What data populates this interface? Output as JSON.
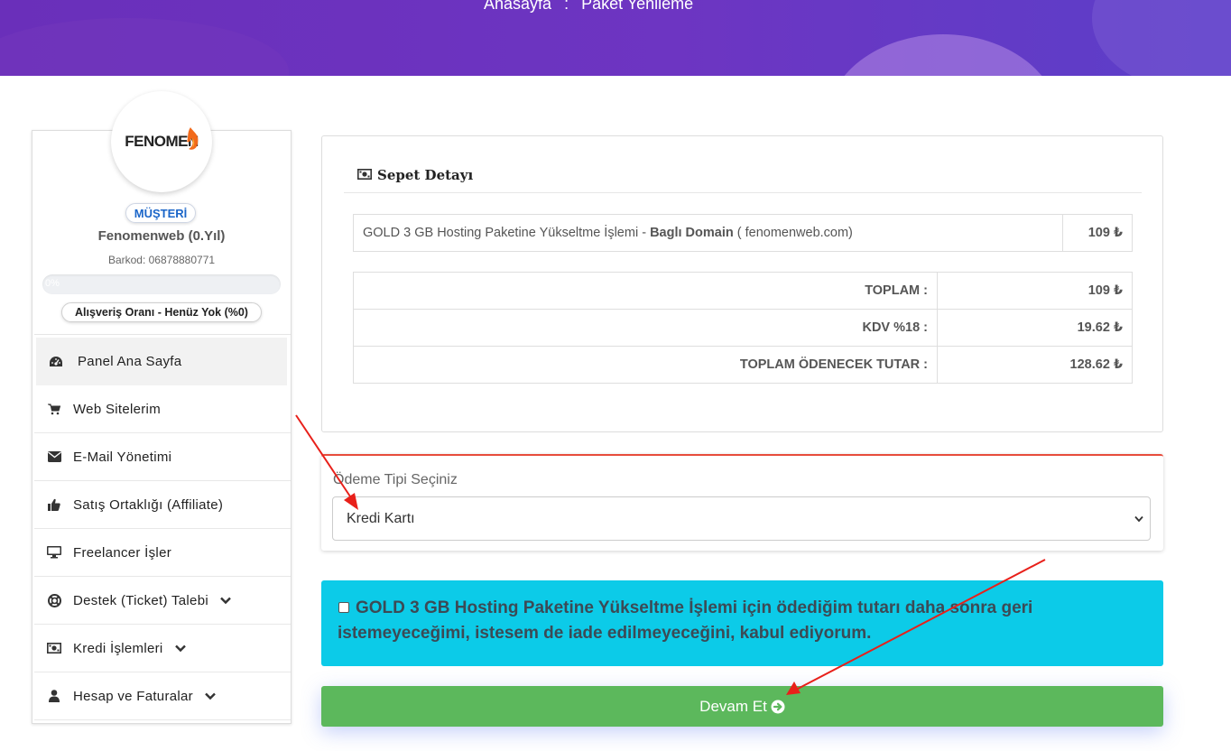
{
  "breadcrumb": {
    "home": "Anasayfa",
    "separator": ":",
    "current": "Paket Yenileme"
  },
  "profile": {
    "logo_text": "FENOMEN",
    "role_badge": "MÜŞTERİ",
    "name": "Fenomenweb (0.Yıl)",
    "barcode": "Barkod: 06878880771",
    "progress_label": "0%",
    "progress_value": 0,
    "shopping_rate": "Alışveriş Oranı - Henüz Yok (%0)"
  },
  "menu": {
    "items": [
      {
        "label": "Panel Ana Sayfa",
        "icon": "dashboard-icon",
        "expandable": false
      },
      {
        "label": "Web Sitelerim",
        "icon": "cart-icon",
        "expandable": false
      },
      {
        "label": "E-Mail Yönetimi",
        "icon": "envelope-icon",
        "expandable": false
      },
      {
        "label": "Satış Ortaklığı (Affiliate)",
        "icon": "thumbs-up-icon",
        "expandable": false
      },
      {
        "label": "Freelancer İşler",
        "icon": "desktop-icon",
        "expandable": false
      },
      {
        "label": "Destek (Ticket) Talebi",
        "icon": "life-ring-icon",
        "expandable": true
      },
      {
        "label": "Kredi İşlemleri",
        "icon": "money-icon",
        "expandable": true
      },
      {
        "label": "Hesap ve Faturalar",
        "icon": "user-icon",
        "expandable": true
      }
    ]
  },
  "cart": {
    "title": "Sepet Detayı",
    "item": {
      "description": "GOLD 3 GB Hosting Paketine Yükseltme İşlemi - ",
      "domain_label": "Baglı Domain",
      "domain": " ( fenomenweb.com)",
      "price": "109 ₺"
    },
    "totals": [
      {
        "label": "TOPLAM :",
        "value": "109 ₺"
      },
      {
        "label": "KDV %18 :",
        "value": "19.62 ₺"
      },
      {
        "label": "TOPLAM ÖDENECEK TUTAR :",
        "value": "128.62 ₺"
      }
    ]
  },
  "payment": {
    "label": "Ödeme Tipi Seçiniz",
    "selected": "Kredi Kartı"
  },
  "agreement": {
    "checked": false,
    "text": "GOLD 3 GB Hosting Paketine Yükseltme İşlemi için ödediğim tutarı daha sonra geri istemeyeceğimi, istesem de iade edilmeyeceğini, kabul ediyorum."
  },
  "continue_button": {
    "label": "Devam Et"
  },
  "colors": {
    "banner": "#6a2fba",
    "agreement_bg": "#0ccbe8",
    "continue_bg": "#5cb85c",
    "accent_border": "#e74c3c",
    "annotation_arrow": "#e8201a"
  }
}
